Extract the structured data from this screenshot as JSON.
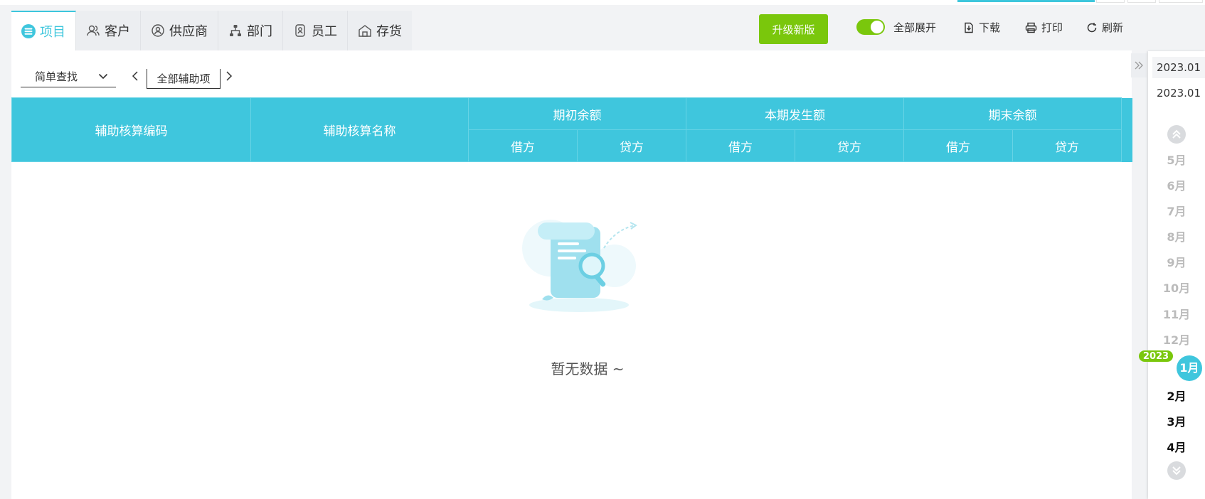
{
  "tabs": [
    {
      "label": "项目",
      "icon": "menu-circle-icon",
      "active": true
    },
    {
      "label": "客户",
      "icon": "users-icon"
    },
    {
      "label": "供应商",
      "icon": "supplier-icon"
    },
    {
      "label": "部门",
      "icon": "org-chart-icon"
    },
    {
      "label": "员工",
      "icon": "id-badge-icon"
    },
    {
      "label": "存货",
      "icon": "warehouse-icon"
    }
  ],
  "toolbar": {
    "upgrade_label": "升级新版",
    "expand_all_label": "全部展开",
    "expand_all_on": true,
    "download_label": "下载",
    "print_label": "打印",
    "refresh_label": "刷新",
    "accent_color": "#3fc6dd",
    "green_color": "#7ac70c"
  },
  "filter": {
    "search_mode": "简单查找",
    "aux_item": "全部辅助项"
  },
  "table": {
    "col_code": "辅助核算编码",
    "col_name": "辅助核算名称",
    "groups": [
      "期初余额",
      "本期发生额",
      "期末余额"
    ],
    "debit": "借方",
    "credit": "贷方"
  },
  "empty": {
    "text": "暂无数据 ~"
  },
  "dates": {
    "start": "2023.01",
    "end": "2023.01",
    "year": "2023",
    "months_prev": [
      "5月",
      "6月",
      "7月",
      "8月",
      "9月",
      "10月",
      "11月",
      "12月"
    ],
    "current": "1月",
    "months_next": [
      "2月",
      "3月",
      "4月"
    ]
  }
}
